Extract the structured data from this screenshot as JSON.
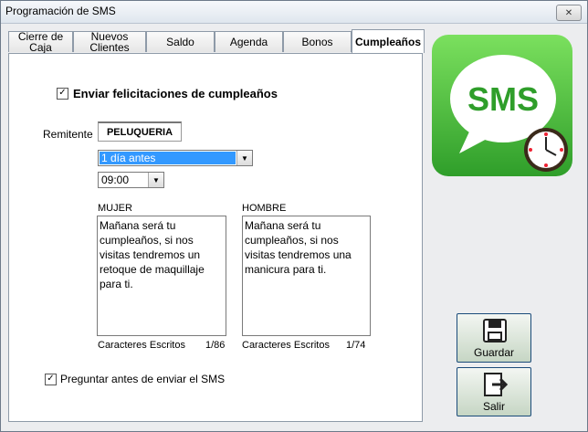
{
  "window": {
    "title": "Programación de SMS"
  },
  "tabs": [
    {
      "label": "Cierre de Caja"
    },
    {
      "label": "Nuevos\nClientes"
    },
    {
      "label": "Saldo"
    },
    {
      "label": "Agenda"
    },
    {
      "label": "Bonos"
    },
    {
      "label": "Cumpleaños",
      "active": true
    }
  ],
  "form": {
    "send_birthday": {
      "label": "Enviar felicitaciones de cumpleaños",
      "checked": true
    },
    "sender": {
      "label": "Remitente",
      "value": "PELUQUERIA"
    },
    "when_select": {
      "value": "1 día antes"
    },
    "time_select": {
      "value": "09:00"
    },
    "woman": {
      "label": "MUJER",
      "message": "Mañana será tu cumpleaños, si nos visitas tendremos un retoque de maquillaje para ti.",
      "counter_label": "Caracteres Escritos",
      "counter_value": "1/86"
    },
    "man": {
      "label": "HOMBRE",
      "message": "Mañana será tu cumpleaños, si nos visitas tendremos una manicura para ti.",
      "counter_label": "Caracteres Escritos",
      "counter_value": "1/74"
    },
    "ask_before": {
      "label": "Preguntar antes de enviar el SMS",
      "checked": true
    }
  },
  "logo": {
    "text": "SMS",
    "colors": {
      "bg": "#3fb13a",
      "bubble": "#ffffff",
      "text": "#2f9e2a"
    }
  },
  "buttons": {
    "save": {
      "label": "Guardar",
      "icon": "floppy-disk-icon"
    },
    "exit": {
      "label": "Salir",
      "icon": "exit-door-icon"
    }
  }
}
